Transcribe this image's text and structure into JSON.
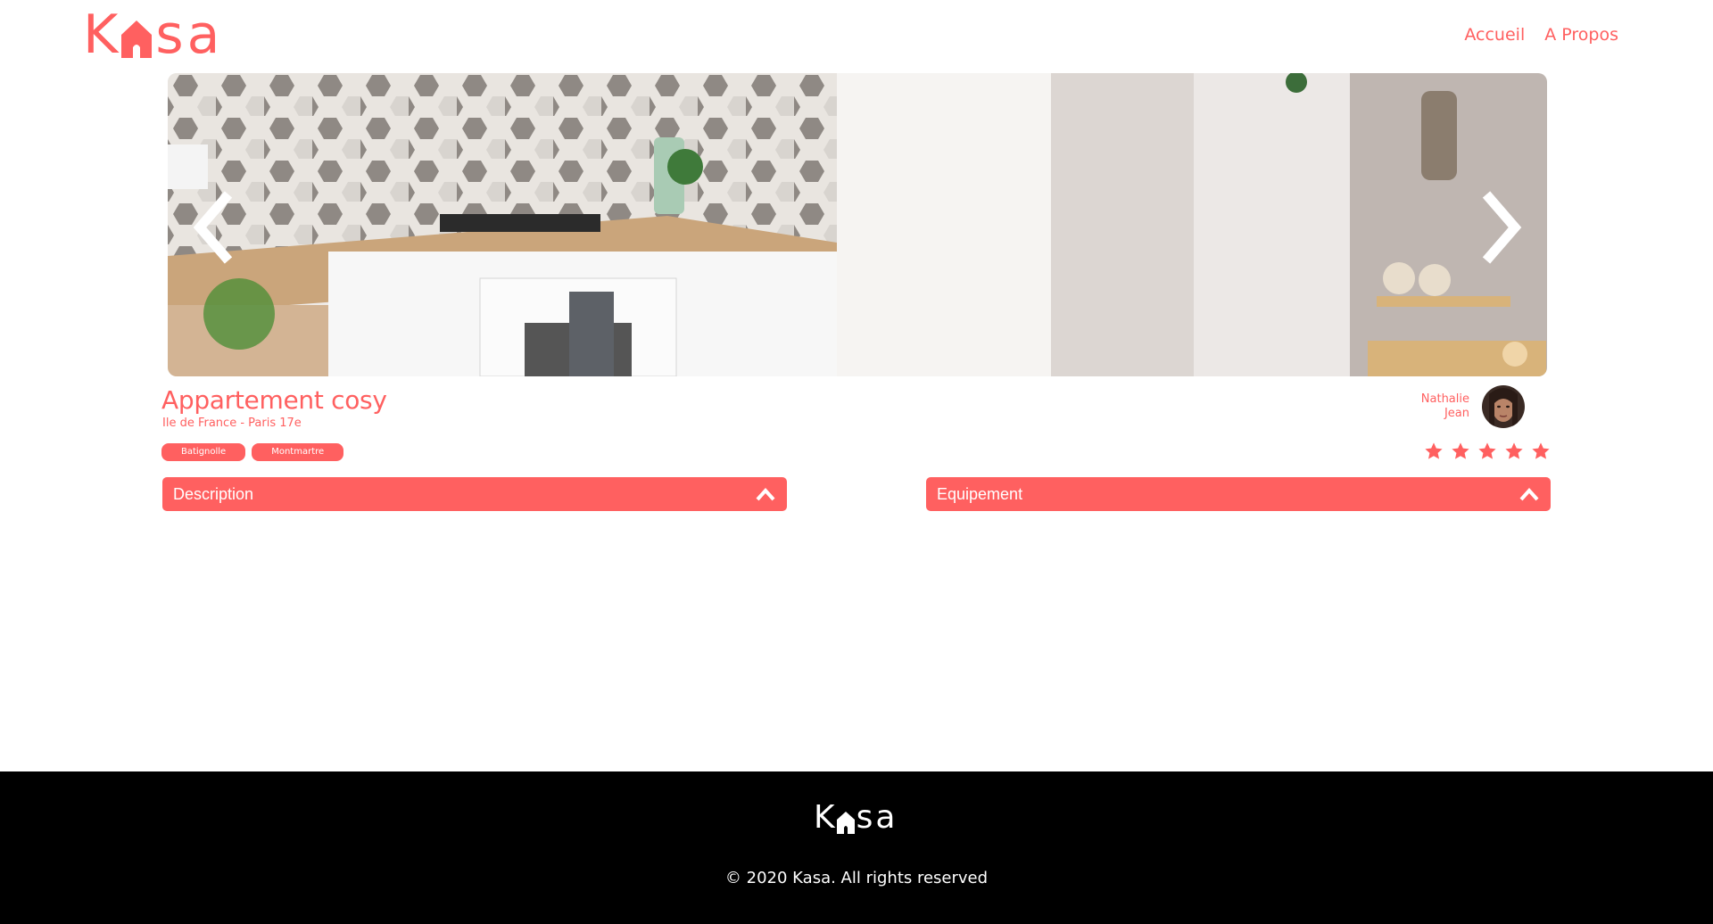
{
  "header": {
    "logo_letter_k": "K",
    "logo_letters_sa": "sa",
    "nav": [
      {
        "label": "Accueil"
      },
      {
        "label": "A Propos"
      }
    ]
  },
  "gallery": {
    "prev_icon": "chevron-left-icon",
    "next_icon": "chevron-right-icon"
  },
  "listing": {
    "title": "Appartement cosy",
    "location": "Ile de France - Paris 17e",
    "tags": [
      "Batignolle",
      "Montmartre"
    ],
    "host": {
      "first_name": "Nathalie",
      "last_name": "Jean"
    },
    "rating": {
      "value": 5,
      "max": 5
    }
  },
  "collapses": {
    "description": {
      "title": "Description",
      "icon": "chevron-up-icon"
    },
    "equipment": {
      "title": "Equipement",
      "icon": "chevron-up-icon"
    }
  },
  "footer": {
    "logo_letter_k": "K",
    "logo_letters_sa": "sa",
    "copyright": "© 2020 Kasa. All rights reserved"
  },
  "colors": {
    "accent": "#ff6060",
    "footer_bg": "#000000",
    "text_on_accent": "#ffffff"
  }
}
